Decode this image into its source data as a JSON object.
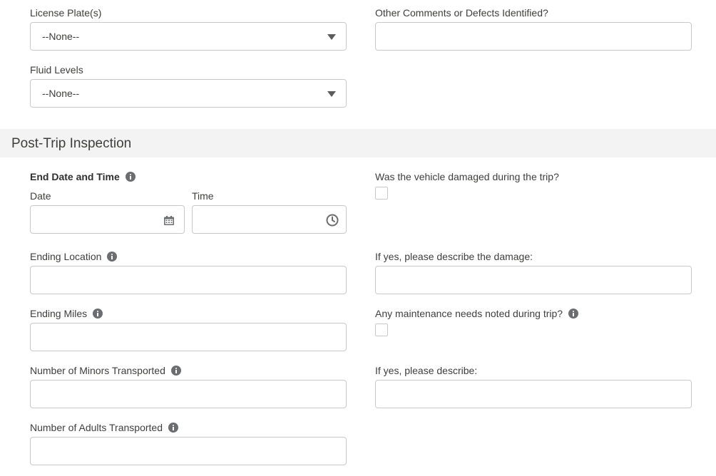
{
  "top": {
    "license_plates": {
      "label": "License Plate(s)",
      "value": "--None--"
    },
    "fluid_levels": {
      "label": "Fluid Levels",
      "value": "--None--"
    },
    "other_comments": {
      "label": "Other Comments or Defects Identified?",
      "value": ""
    }
  },
  "post_trip": {
    "section_title": "Post-Trip Inspection",
    "end_datetime": {
      "label": "End Date and Time",
      "date_label": "Date",
      "time_label": "Time",
      "date_value": "",
      "time_value": ""
    },
    "ending_location": {
      "label": "Ending Location",
      "value": ""
    },
    "ending_miles": {
      "label": "Ending Miles",
      "value": ""
    },
    "minors_transported": {
      "label": "Number of Minors Transported",
      "value": ""
    },
    "adults_transported": {
      "label": "Number of Adults Transported",
      "value": ""
    },
    "vehicle_damaged": {
      "label": "Was the vehicle damaged during the trip?",
      "checked": false
    },
    "damage_description": {
      "label": "If yes, please describe the damage:",
      "value": ""
    },
    "maintenance_needs": {
      "label": "Any maintenance needs noted during trip?",
      "checked": false
    },
    "maintenance_description": {
      "label": "If yes, please describe:",
      "value": ""
    }
  },
  "icons": {
    "info": "info-icon",
    "calendar": "calendar-icon",
    "clock": "clock-icon",
    "dropdown": "chevron-down-icon"
  },
  "colors": {
    "border": "#c9c9c9",
    "section_background": "#f3f3f3",
    "text": "#3e3e3c",
    "icon": "#6b6d70"
  }
}
